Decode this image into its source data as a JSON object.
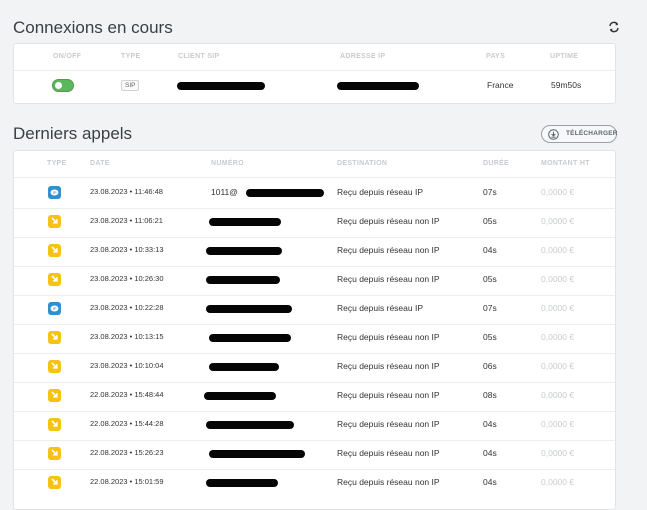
{
  "connexions": {
    "title": "Connexions en cours",
    "headers": [
      "ON/OFF",
      "TYPE",
      "CLIENT SIP",
      "ADRESSE IP",
      "PAYS",
      "UPTIME"
    ],
    "row": {
      "status": "on",
      "type": "SIP",
      "pays": "France",
      "uptime": "59m50s"
    }
  },
  "appels": {
    "title": "Derniers appels",
    "download_label": "TÉLÉCHARGER",
    "headers": [
      "TYPE",
      "DATE",
      "NUMÉRO",
      "DESTINATION",
      "DURÉE",
      "MONTANT HT"
    ],
    "rows": [
      {
        "icon": "ip-call-icon",
        "kind": "ip",
        "date": "23.08.2023 • 11:46:48",
        "numero_visible": "1011@",
        "destination": "Reçu depuis réseau IP",
        "duree": "07s",
        "montant": "0,0000 €"
      },
      {
        "icon": "incoming-call-icon",
        "kind": "in",
        "date": "23.08.2023 • 11:06:21",
        "numero_visible": "",
        "destination": "Reçu depuis réseau non IP",
        "duree": "05s",
        "montant": "0,0000 €"
      },
      {
        "icon": "incoming-call-icon",
        "kind": "in",
        "date": "23.08.2023 • 10:33:13",
        "numero_visible": "",
        "destination": "Reçu depuis réseau non IP",
        "duree": "04s",
        "montant": "0,0000 €"
      },
      {
        "icon": "incoming-call-icon",
        "kind": "in",
        "date": "23.08.2023 • 10:26:30",
        "numero_visible": "",
        "destination": "Reçu depuis réseau non IP",
        "duree": "05s",
        "montant": "0,0000 €"
      },
      {
        "icon": "ip-call-icon",
        "kind": "ip",
        "date": "23.08.2023 • 10:22:28",
        "numero_visible": "",
        "destination": "Reçu depuis réseau IP",
        "duree": "07s",
        "montant": "0,0000 €"
      },
      {
        "icon": "incoming-call-icon",
        "kind": "in",
        "date": "23.08.2023 • 10:13:15",
        "numero_visible": "",
        "destination": "Reçu depuis réseau non IP",
        "duree": "05s",
        "montant": "0,0000 €"
      },
      {
        "icon": "incoming-call-icon",
        "kind": "in",
        "date": "23.08.2023 • 10:10:04",
        "numero_visible": "",
        "destination": "Reçu depuis réseau non IP",
        "duree": "06s",
        "montant": "0,0000 €"
      },
      {
        "icon": "incoming-call-icon",
        "kind": "in",
        "date": "22.08.2023 • 15:48:44",
        "numero_visible": "",
        "destination": "Reçu depuis réseau non IP",
        "duree": "08s",
        "montant": "0,0000 €"
      },
      {
        "icon": "incoming-call-icon",
        "kind": "in",
        "date": "22.08.2023 • 15:44:28",
        "numero_visible": "",
        "destination": "Reçu depuis réseau non IP",
        "duree": "04s",
        "montant": "0,0000 €"
      },
      {
        "icon": "incoming-call-icon",
        "kind": "in",
        "date": "22.08.2023 • 15:26:23",
        "numero_visible": "",
        "destination": "Reçu depuis réseau non IP",
        "duree": "04s",
        "montant": "0,0000 €"
      },
      {
        "icon": "incoming-call-icon",
        "kind": "in",
        "date": "22.08.2023 • 15:01:59",
        "numero_visible": "",
        "destination": "Reçu depuis réseau non IP",
        "duree": "04s",
        "montant": "0,0000 €"
      }
    ]
  },
  "colors": {
    "toggle_on": "#5cb85c",
    "incoming_icon": "#f5c412",
    "ip_icon": "#2e8fd1"
  }
}
